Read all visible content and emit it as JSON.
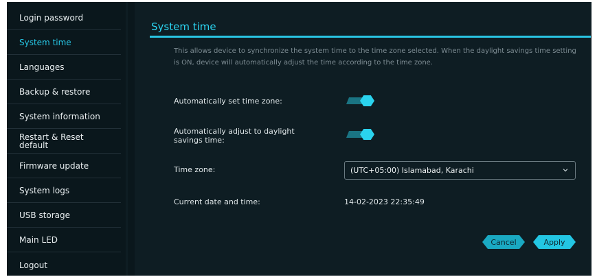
{
  "sidebar": {
    "items": [
      {
        "label": "Login password"
      },
      {
        "label": "System time"
      },
      {
        "label": "Languages"
      },
      {
        "label": "Backup & restore"
      },
      {
        "label": "System information"
      },
      {
        "label": "Restart & Reset default"
      },
      {
        "label": "Firmware update"
      },
      {
        "label": "System logs"
      },
      {
        "label": "USB storage"
      },
      {
        "label": "Main LED"
      },
      {
        "label": "Logout"
      }
    ],
    "active_index": 1
  },
  "main": {
    "title": "System time",
    "description": "This allows device to synchronize the system time to the time zone selected. When the daylight savings time setting is ON, device will automatically adjust the time according to the time zone.",
    "auto_timezone": {
      "label": "Automatically set time zone:",
      "on": true
    },
    "auto_dst": {
      "label": "Automatically adjust to daylight savings time:",
      "on": true
    },
    "timezone": {
      "label": "Time zone:",
      "value": "(UTC+05:00) Islamabad, Karachi"
    },
    "current_time": {
      "label": "Current date and time:",
      "value": "14-02-2023 22:35:49"
    },
    "buttons": {
      "cancel": "Cancel",
      "apply": "Apply"
    }
  },
  "colors": {
    "background": "#0e1d23",
    "sidebar": "#0a171c",
    "accent": "#29c5e3"
  }
}
